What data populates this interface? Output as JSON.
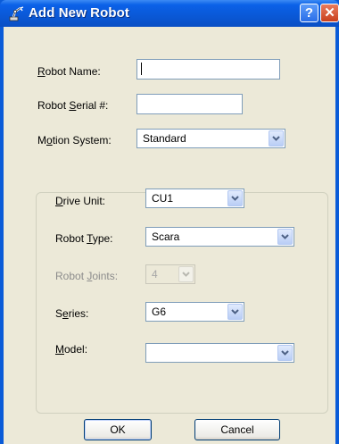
{
  "window": {
    "title": "Add New Robot",
    "help_label": "?",
    "close_label": "✕",
    "icon": "robot-arm-icon",
    "colors": {
      "titlebar": "#0a58d6",
      "client": "#ece9d8"
    }
  },
  "form": {
    "robot_name": {
      "label_pre": "",
      "label_u": "R",
      "label_post": "obot Name:",
      "value": ""
    },
    "robot_serial": {
      "label_pre": "Robot ",
      "label_u": "S",
      "label_post": "erial #:",
      "value": ""
    },
    "motion_system": {
      "label_pre": "M",
      "label_u": "o",
      "label_post": "tion System:",
      "value": "Standard"
    }
  },
  "group": {
    "drive_unit": {
      "label_pre": "",
      "label_u": "D",
      "label_post": "rive Unit:",
      "value": "CU1"
    },
    "robot_type": {
      "label_pre": "Robot ",
      "label_u": "T",
      "label_post": "ype:",
      "value": "Scara"
    },
    "robot_joints": {
      "label_pre": "Robot ",
      "label_u": "J",
      "label_post": "oints:",
      "value": "4"
    },
    "series": {
      "label_pre": "S",
      "label_u": "e",
      "label_post": "ries:",
      "value": "G6"
    },
    "model": {
      "label_pre": "",
      "label_u": "M",
      "label_post": "odel:",
      "value": ""
    }
  },
  "buttons": {
    "ok": "OK",
    "cancel": "Cancel"
  }
}
